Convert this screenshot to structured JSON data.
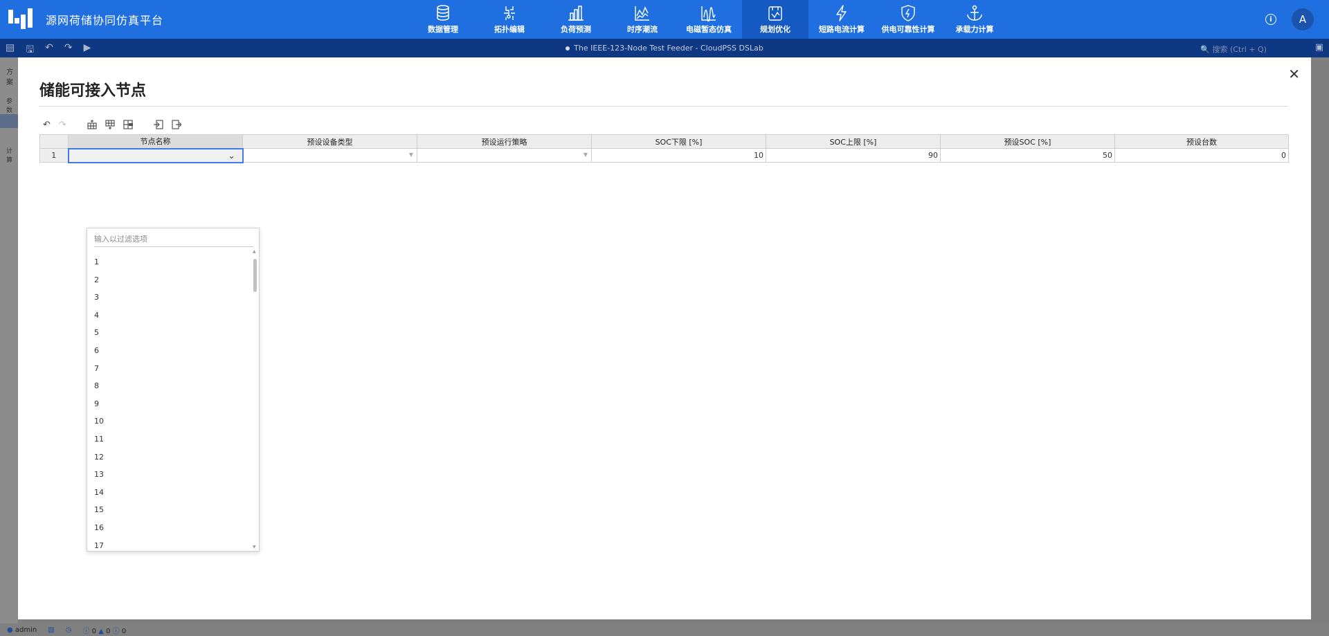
{
  "header": {
    "app_title": "源网荷储协同仿真平台",
    "nav": [
      {
        "label": "数据管理",
        "icon": "database-icon"
      },
      {
        "label": "拓扑编辑",
        "icon": "topology-icon"
      },
      {
        "label": "负荷预测",
        "icon": "bar-chart-icon"
      },
      {
        "label": "时序潮流",
        "icon": "line-chart-icon"
      },
      {
        "label": "电磁暂态仿真",
        "icon": "waveform-icon"
      },
      {
        "label": "规划优化",
        "icon": "planning-icon",
        "active": true
      },
      {
        "label": "短路电流计算",
        "icon": "lightning-icon"
      },
      {
        "label": "供电可靠性计算",
        "icon": "shield-icon"
      },
      {
        "label": "承载力计算",
        "icon": "anchor-icon"
      }
    ],
    "avatar_letter": "A"
  },
  "toolbar": {
    "doc_title": "The IEEE-123-Node Test Feeder - CloudPSS DSLab",
    "search_placeholder": "搜索 (Ctrl + Q)"
  },
  "left_panel": {
    "label_1": "方案",
    "label_2": "参数",
    "label_3": "计算"
  },
  "modal": {
    "title": "储能可接入节点",
    "columns": [
      "节点名称",
      "预设设备类型",
      "预设运行策略",
      "SOC下限 [%]",
      "SOC上限 [%]",
      "预设SOC [%]",
      "预设台数"
    ],
    "rows": [
      {
        "index": "1",
        "node_name": "",
        "device_type": "",
        "strategy": "",
        "soc_min": "10",
        "soc_max": "90",
        "soc_preset": "50",
        "count": "0"
      }
    ],
    "dropdown": {
      "filter_placeholder": "输入以过滤选项",
      "options": [
        "1",
        "2",
        "3",
        "4",
        "5",
        "6",
        "7",
        "8",
        "9",
        "10",
        "11",
        "12",
        "13",
        "14",
        "15",
        "16",
        "17"
      ]
    }
  },
  "statusbar": {
    "user": "admin",
    "info_count": "0",
    "warning_count": "0",
    "error_count": "0"
  },
  "colors": {
    "primary": "#1f6fe0",
    "primary_dark": "#1559c2",
    "toolbar_bg": "#0e3882",
    "selection_border": "#3e7be6"
  }
}
